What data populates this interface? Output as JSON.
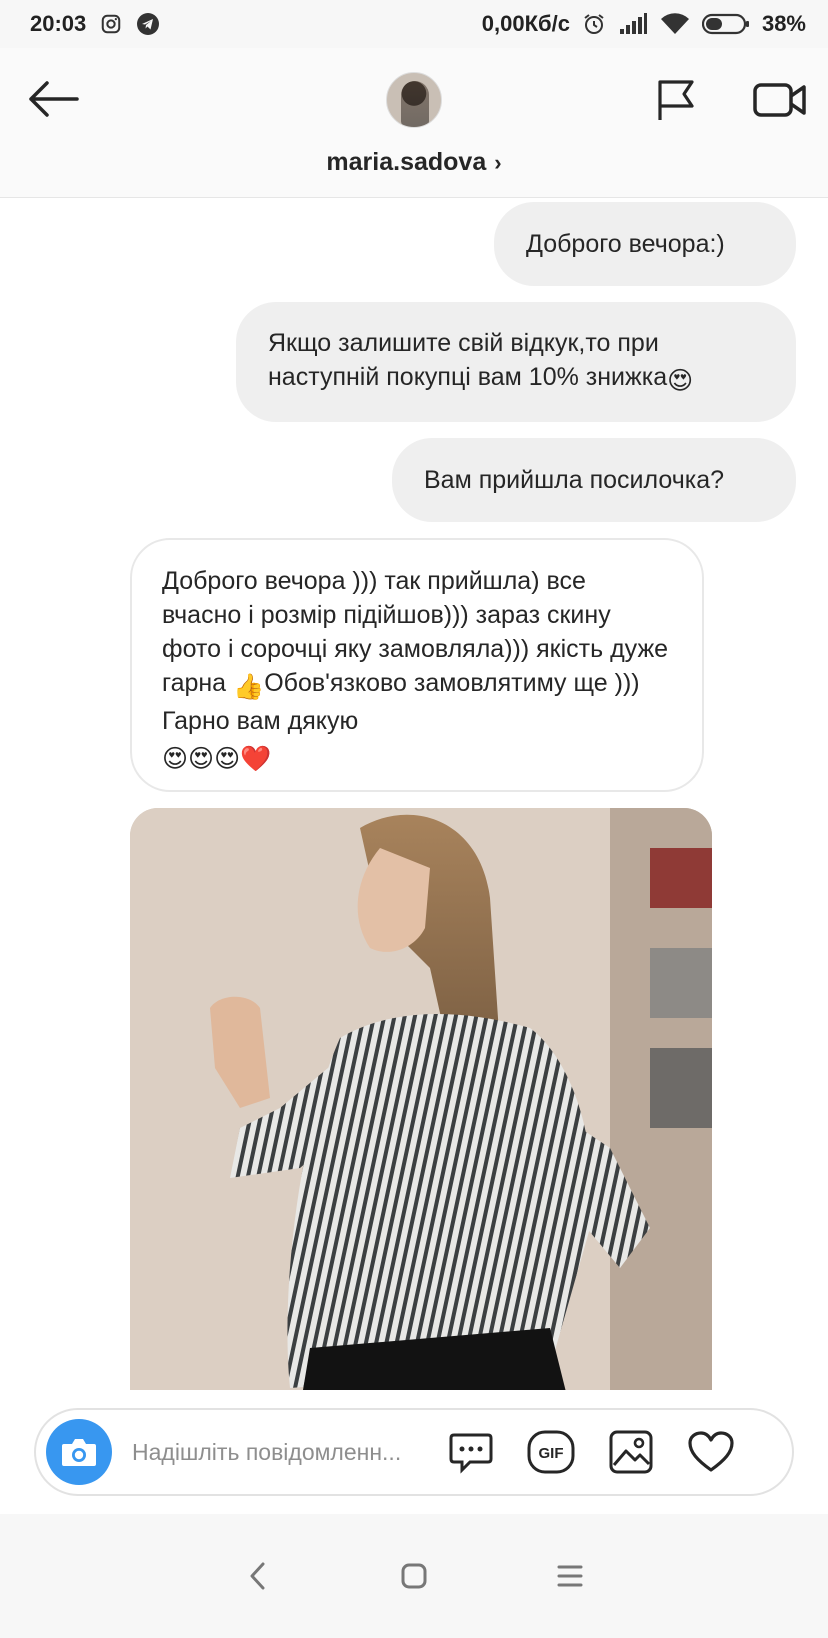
{
  "status_bar": {
    "time": "20:03",
    "network_speed": "0,00Кб/с",
    "battery": "38%",
    "icons": [
      "instagram-icon",
      "telegram-icon",
      "alarm-icon",
      "signal-icon",
      "wifi-icon",
      "battery-icon"
    ]
  },
  "header": {
    "username": "maria.sadova",
    "chevron": "›",
    "icons": [
      "back-arrow-icon",
      "flag-icon",
      "video-call-icon"
    ]
  },
  "messages": [
    {
      "direction": "outgoing",
      "text": "Доброго вечора:)"
    },
    {
      "direction": "outgoing",
      "text": "Якщо залишите свій відкук,то при наступній покупці вам 10% знижка",
      "emoji": "😍"
    },
    {
      "direction": "outgoing",
      "text": "Вам прийшла посилочка?"
    },
    {
      "direction": "incoming",
      "text": "Доброго вечора ))) так прийшла) все вчасно і розмір підійшов))) зараз скину фото і сорочці яку замовляла))) якість дуже гарна ",
      "emoji_mid": "👍",
      "text_after": "Обов'язково замовлятиму ще ))) Гарно вам дякую",
      "emoji_end": "😍😍😍❤️"
    },
    {
      "direction": "incoming",
      "type": "photo"
    }
  ],
  "composer": {
    "placeholder": "Надішліть повідомленн...",
    "gif_label": "GIF",
    "icons": [
      "camera-icon",
      "chat-bubble-icon",
      "gif-icon",
      "gallery-icon",
      "heart-icon"
    ]
  },
  "nav_bar": {
    "icons": [
      "nav-back-icon",
      "nav-home-icon",
      "nav-menu-icon"
    ]
  },
  "colors": {
    "accent": "#3897f0",
    "bubble_out": "#efefef",
    "bubble_in_border": "#e8e8e8",
    "text": "#262626",
    "placeholder": "#8e8e8e"
  }
}
